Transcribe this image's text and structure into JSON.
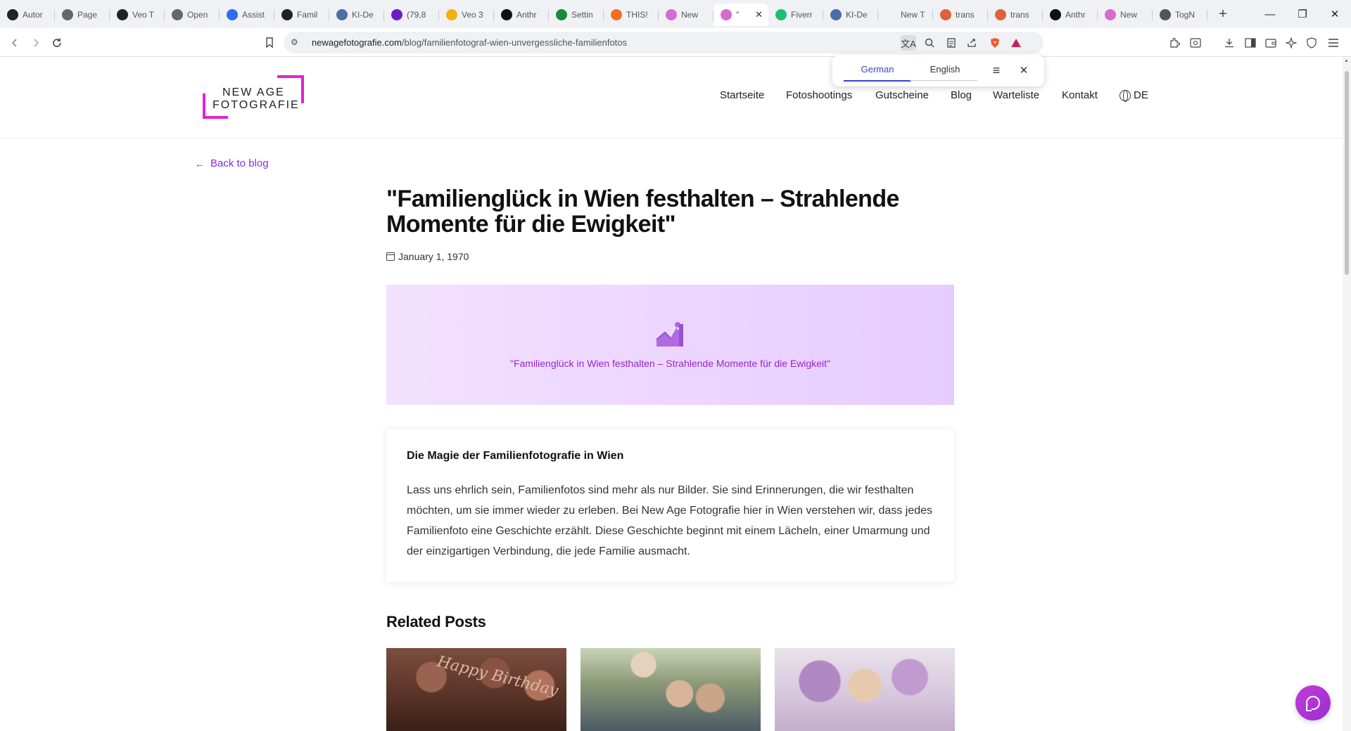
{
  "browser": {
    "tabs": [
      {
        "label": "Autor",
        "color": "#222"
      },
      {
        "label": "Page",
        "color": "#666"
      },
      {
        "label": "Veo T",
        "color": "#222"
      },
      {
        "label": "Open",
        "color": "#666"
      },
      {
        "label": "Assist",
        "color": "#2b6ef5"
      },
      {
        "label": "Famil",
        "color": "#222"
      },
      {
        "label": "KI-De",
        "color": "#4b6ea8"
      },
      {
        "label": "(79,8",
        "color": "#6a1ec9"
      },
      {
        "label": "Veo 3",
        "color": "#f2b20c"
      },
      {
        "label": "Anthr",
        "color": "#111"
      },
      {
        "label": "Settin",
        "color": "#1a8a3a"
      },
      {
        "label": "THIS!",
        "color": "#f07020"
      },
      {
        "label": "New",
        "color": "#d86bd0"
      },
      {
        "label": "\"",
        "color": "#d86bd0"
      },
      {
        "label": "Fiverr",
        "color": "#1dbf73"
      },
      {
        "label": "KI-De",
        "color": "#4b6ea8"
      },
      {
        "label": "New Tab",
        "color": ""
      },
      {
        "label": "trans",
        "color": "#e0603a"
      },
      {
        "label": "trans",
        "color": "#e0603a"
      },
      {
        "label": "Anthr",
        "color": "#111"
      },
      {
        "label": "New",
        "color": "#d86bd0"
      },
      {
        "label": "TogN",
        "color": "#555"
      }
    ],
    "active_tab_index": 13,
    "new_tab_label": "+",
    "url_host": "newagefotografie.com",
    "url_path": "/blog/familienfotograf-wien-unvergessliche-familienfotos",
    "window_minimize": "—",
    "window_restore": "❐",
    "window_close": "✕"
  },
  "translate_popup": {
    "source_lang": "German",
    "target_lang": "English",
    "menu_icon": "≡",
    "close_icon": "✕"
  },
  "site": {
    "logo_line1": "NEW AGE",
    "logo_line2": "FOTOGRAFIE",
    "logo_color": "#e321d8",
    "nav": [
      "Startseite",
      "Fotoshootings",
      "Gutscheine",
      "Blog",
      "Warteliste",
      "Kontakt"
    ],
    "language": "DE"
  },
  "article": {
    "back_link": "Back to blog",
    "title": "\"Familienglück in Wien festhalten – Strahlende Momente für die Ewigkeit\"",
    "date": "January 1, 1970",
    "hero_caption": "\"Familienglück in Wien festhalten – Strahlende Momente für die Ewigkeit\"",
    "section_heading": "Die Magie der Familienfotografie in Wien",
    "paragraph": "Lass uns ehrlich sein, Familienfotos sind mehr als nur Bilder. Sie sind Erinnerungen, die wir festhalten möchten, um sie immer wieder zu erleben. Bei New Age Fotografie hier in Wien verstehen wir, dass jedes Familienfoto eine Geschichte erzählt. Diese Geschichte beginnt mit einem Lächeln, einer Umarmung und der einzigartigen Verbindung, die jede Familie ausmacht.",
    "accent_color": "#8a2be2"
  },
  "related": {
    "heading": "Related Posts",
    "cake_text": "Happy Birthday"
  }
}
